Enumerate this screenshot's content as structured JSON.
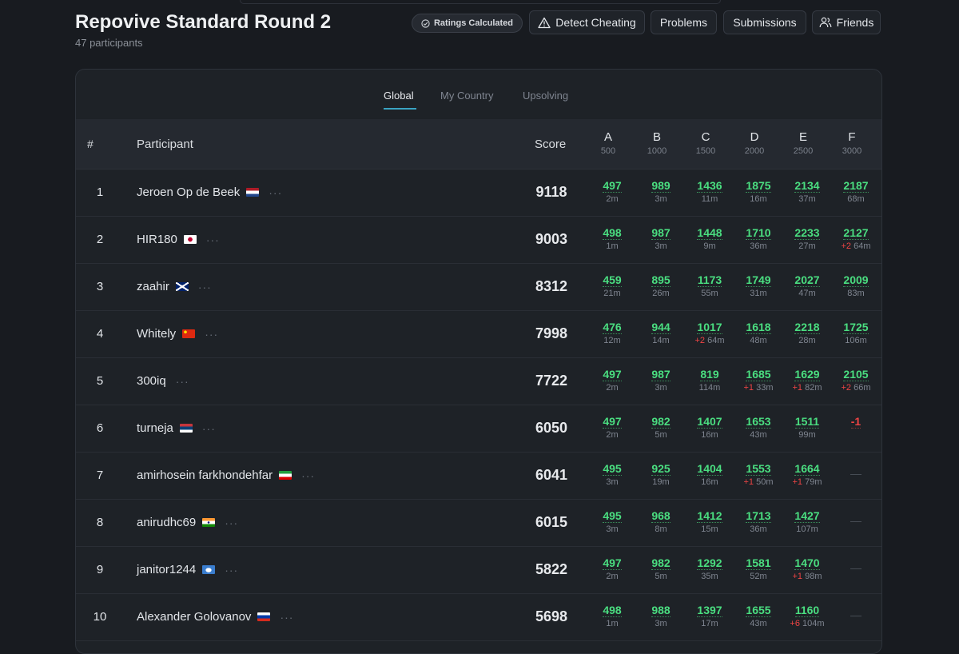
{
  "contest": {
    "title": "Repovive Standard Round 2",
    "participants": "47 participants"
  },
  "toolbar": {
    "ratings_badge": "Ratings Calculated",
    "detect_cheating": "Detect Cheating",
    "problems": "Problems",
    "submissions": "Submissions",
    "friends": "Friends"
  },
  "tabs": [
    {
      "label": "Global",
      "active": true
    },
    {
      "label": "My Country"
    },
    {
      "label": "Upsolving"
    }
  ],
  "columns": {
    "rank": "#",
    "participant": "Participant",
    "score": "Score"
  },
  "problems": [
    {
      "letter": "A",
      "points": "500"
    },
    {
      "letter": "B",
      "points": "1000"
    },
    {
      "letter": "C",
      "points": "1500"
    },
    {
      "letter": "D",
      "points": "2000"
    },
    {
      "letter": "E",
      "points": "2500"
    },
    {
      "letter": "F",
      "points": "3000"
    }
  ],
  "rows": [
    {
      "rank": "1",
      "name": "Jeroen Op de Beek",
      "flag": "netherlands",
      "score": "9118",
      "cells": [
        {
          "v": "497",
          "t": "2m"
        },
        {
          "v": "989",
          "t": "3m"
        },
        {
          "v": "1436",
          "t": "11m"
        },
        {
          "v": "1875",
          "t": "16m"
        },
        {
          "v": "2134",
          "t": "37m"
        },
        {
          "v": "2187",
          "t": "68m"
        }
      ]
    },
    {
      "rank": "2",
      "name": "HIR180",
      "flag": "japan",
      "score": "9003",
      "cells": [
        {
          "v": "498",
          "t": "1m"
        },
        {
          "v": "987",
          "t": "3m"
        },
        {
          "v": "1448",
          "t": "9m"
        },
        {
          "v": "1710",
          "t": "36m"
        },
        {
          "v": "2233",
          "t": "27m"
        },
        {
          "v": "2127",
          "p": "+2",
          "t": "64m"
        }
      ]
    },
    {
      "rank": "3",
      "name": "zaahir",
      "flag": "uk",
      "score": "8312",
      "cells": [
        {
          "v": "459",
          "t": "21m"
        },
        {
          "v": "895",
          "t": "26m"
        },
        {
          "v": "1173",
          "t": "55m"
        },
        {
          "v": "1749",
          "t": "31m"
        },
        {
          "v": "2027",
          "t": "47m"
        },
        {
          "v": "2009",
          "t": "83m"
        }
      ]
    },
    {
      "rank": "4",
      "name": "Whitely",
      "flag": "china",
      "score": "7998",
      "cells": [
        {
          "v": "476",
          "t": "12m"
        },
        {
          "v": "944",
          "t": "14m"
        },
        {
          "v": "1017",
          "p": "+2",
          "t": "64m"
        },
        {
          "v": "1618",
          "t": "48m"
        },
        {
          "v": "2218",
          "t": "28m"
        },
        {
          "v": "1725",
          "t": "106m"
        }
      ]
    },
    {
      "rank": "5",
      "name": "300iq",
      "flag": "",
      "score": "7722",
      "cells": [
        {
          "v": "497",
          "t": "2m"
        },
        {
          "v": "987",
          "t": "3m"
        },
        {
          "v": "819",
          "t": "114m"
        },
        {
          "v": "1685",
          "p": "+1",
          "t": "33m"
        },
        {
          "v": "1629",
          "p": "+1",
          "t": "82m"
        },
        {
          "v": "2105",
          "p": "+2",
          "t": "66m"
        }
      ]
    },
    {
      "rank": "6",
      "name": "turneja",
      "flag": "serbia",
      "score": "6050",
      "cells": [
        {
          "v": "497",
          "t": "2m"
        },
        {
          "v": "982",
          "t": "5m"
        },
        {
          "v": "1407",
          "t": "16m"
        },
        {
          "v": "1653",
          "t": "43m"
        },
        {
          "v": "1511",
          "t": "99m"
        },
        {
          "v": "-1",
          "neg": true
        }
      ]
    },
    {
      "rank": "7",
      "name": "amirhosein farkhondehfar",
      "flag": "iran",
      "score": "6041",
      "cells": [
        {
          "v": "495",
          "t": "3m"
        },
        {
          "v": "925",
          "t": "19m"
        },
        {
          "v": "1404",
          "t": "16m"
        },
        {
          "v": "1553",
          "p": "+1",
          "t": "50m"
        },
        {
          "v": "1664",
          "p": "+1",
          "t": "79m"
        },
        {
          "empty": true,
          "v": "—"
        }
      ]
    },
    {
      "rank": "8",
      "name": "anirudhc69",
      "flag": "india",
      "score": "6015",
      "cells": [
        {
          "v": "495",
          "t": "3m"
        },
        {
          "v": "968",
          "t": "8m"
        },
        {
          "v": "1412",
          "t": "15m"
        },
        {
          "v": "1713",
          "t": "36m"
        },
        {
          "v": "1427",
          "t": "107m"
        },
        {
          "empty": true,
          "v": "—"
        }
      ]
    },
    {
      "rank": "9",
      "name": "janitor1244",
      "flag": "antarctica",
      "score": "5822",
      "cells": [
        {
          "v": "497",
          "t": "2m"
        },
        {
          "v": "982",
          "t": "5m"
        },
        {
          "v": "1292",
          "t": "35m"
        },
        {
          "v": "1581",
          "t": "52m"
        },
        {
          "v": "1470",
          "p": "+1",
          "t": "98m"
        },
        {
          "empty": true,
          "v": "—"
        }
      ]
    },
    {
      "rank": "10",
      "name": "Alexander Golovanov",
      "flag": "russia",
      "score": "5698",
      "cells": [
        {
          "v": "498",
          "t": "1m"
        },
        {
          "v": "988",
          "t": "3m"
        },
        {
          "v": "1397",
          "t": "17m"
        },
        {
          "v": "1655",
          "t": "43m"
        },
        {
          "v": "1160",
          "p": "+6",
          "t": "104m"
        },
        {
          "empty": true,
          "v": "—"
        }
      ]
    }
  ]
}
